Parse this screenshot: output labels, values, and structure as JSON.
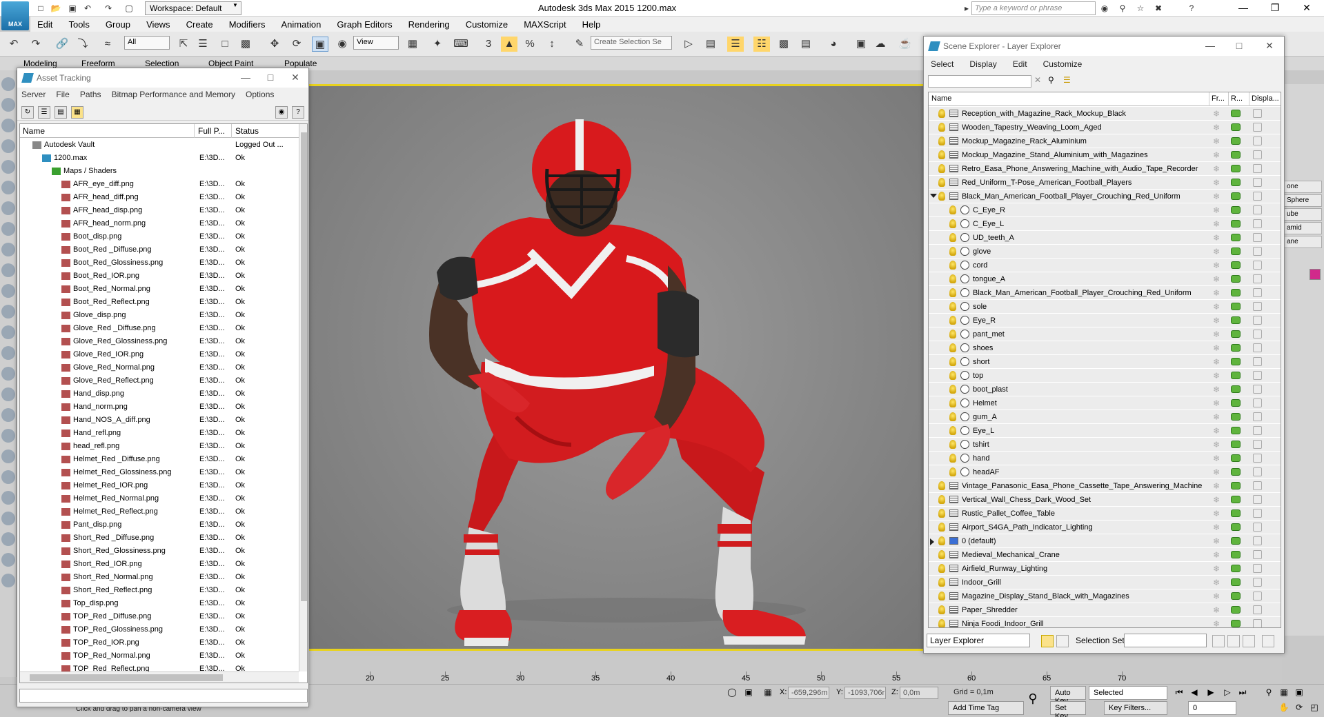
{
  "app": {
    "logo_text": "MAX",
    "title": "Autodesk 3ds Max  2015     1200.max",
    "workspace": "Workspace: Default",
    "search_placeholder": "Type a keyword or phrase"
  },
  "menu": [
    "Edit",
    "Tools",
    "Group",
    "Views",
    "Create",
    "Modifiers",
    "Animation",
    "Graph Editors",
    "Rendering",
    "Customize",
    "MAXScript",
    "Help"
  ],
  "toolbar": {
    "selection_filter": "All",
    "ref_coord": "View",
    "named_selection_placeholder": "Create Selection Se"
  },
  "ribbon_tabs": [
    "Modeling",
    "Freeform",
    "Selection",
    "Object Paint",
    "Populate"
  ],
  "right_panel": {
    "buttons": [
      "one",
      "Sphere",
      "ube",
      "amid",
      "ane"
    ],
    "accent": "#d12a8b"
  },
  "asset_tracking": {
    "title": "Asset Tracking",
    "menu": [
      "Server",
      "File",
      "Paths",
      "Bitmap Performance and Memory",
      "Options"
    ],
    "columns": [
      "Name",
      "Full P...",
      "Status"
    ],
    "rows": [
      {
        "name": "Autodesk Vault",
        "path": "",
        "status": "Logged Out ...",
        "level": 0,
        "icon": "vault"
      },
      {
        "name": "1200.max",
        "path": "E:\\3D...",
        "status": "Ok",
        "level": 1,
        "icon": "max-file"
      },
      {
        "name": "Maps / Shaders",
        "path": "",
        "status": "",
        "level": 2,
        "icon": "folder"
      },
      {
        "name": "AFR_eye_diff.png",
        "path": "E:\\3D...",
        "status": "Ok",
        "level": 3,
        "icon": "bitmap"
      },
      {
        "name": "AFR_head_diff.png",
        "path": "E:\\3D...",
        "status": "Ok",
        "level": 3,
        "icon": "bitmap"
      },
      {
        "name": "AFR_head_disp.png",
        "path": "E:\\3D...",
        "status": "Ok",
        "level": 3,
        "icon": "bitmap"
      },
      {
        "name": "AFR_head_norm.png",
        "path": "E:\\3D...",
        "status": "Ok",
        "level": 3,
        "icon": "bitmap"
      },
      {
        "name": "Boot_disp.png",
        "path": "E:\\3D...",
        "status": "Ok",
        "level": 3,
        "icon": "bitmap"
      },
      {
        "name": "Boot_Red _Diffuse.png",
        "path": "E:\\3D...",
        "status": "Ok",
        "level": 3,
        "icon": "bitmap"
      },
      {
        "name": "Boot_Red_Glossiness.png",
        "path": "E:\\3D...",
        "status": "Ok",
        "level": 3,
        "icon": "bitmap"
      },
      {
        "name": "Boot_Red_IOR.png",
        "path": "E:\\3D...",
        "status": "Ok",
        "level": 3,
        "icon": "bitmap"
      },
      {
        "name": "Boot_Red_Normal.png",
        "path": "E:\\3D...",
        "status": "Ok",
        "level": 3,
        "icon": "bitmap"
      },
      {
        "name": "Boot_Red_Reflect.png",
        "path": "E:\\3D...",
        "status": "Ok",
        "level": 3,
        "icon": "bitmap"
      },
      {
        "name": "Glove_disp.png",
        "path": "E:\\3D...",
        "status": "Ok",
        "level": 3,
        "icon": "bitmap"
      },
      {
        "name": "Glove_Red _Diffuse.png",
        "path": "E:\\3D...",
        "status": "Ok",
        "level": 3,
        "icon": "bitmap"
      },
      {
        "name": "Glove_Red_Glossiness.png",
        "path": "E:\\3D...",
        "status": "Ok",
        "level": 3,
        "icon": "bitmap"
      },
      {
        "name": "Glove_Red_IOR.png",
        "path": "E:\\3D...",
        "status": "Ok",
        "level": 3,
        "icon": "bitmap"
      },
      {
        "name": "Glove_Red_Normal.png",
        "path": "E:\\3D...",
        "status": "Ok",
        "level": 3,
        "icon": "bitmap"
      },
      {
        "name": "Glove_Red_Reflect.png",
        "path": "E:\\3D...",
        "status": "Ok",
        "level": 3,
        "icon": "bitmap"
      },
      {
        "name": "Hand_disp.png",
        "path": "E:\\3D...",
        "status": "Ok",
        "level": 3,
        "icon": "bitmap"
      },
      {
        "name": "Hand_norm.png",
        "path": "E:\\3D...",
        "status": "Ok",
        "level": 3,
        "icon": "bitmap"
      },
      {
        "name": "Hand_NOS_A_diff.png",
        "path": "E:\\3D...",
        "status": "Ok",
        "level": 3,
        "icon": "bitmap"
      },
      {
        "name": "Hand_refl.png",
        "path": "E:\\3D...",
        "status": "Ok",
        "level": 3,
        "icon": "bitmap"
      },
      {
        "name": "head_refl.png",
        "path": "E:\\3D...",
        "status": "Ok",
        "level": 3,
        "icon": "bitmap"
      },
      {
        "name": "Helmet_Red _Diffuse.png",
        "path": "E:\\3D...",
        "status": "Ok",
        "level": 3,
        "icon": "bitmap"
      },
      {
        "name": "Helmet_Red_Glossiness.png",
        "path": "E:\\3D...",
        "status": "Ok",
        "level": 3,
        "icon": "bitmap"
      },
      {
        "name": "Helmet_Red_IOR.png",
        "path": "E:\\3D...",
        "status": "Ok",
        "level": 3,
        "icon": "bitmap"
      },
      {
        "name": "Helmet_Red_Normal.png",
        "path": "E:\\3D...",
        "status": "Ok",
        "level": 3,
        "icon": "bitmap"
      },
      {
        "name": "Helmet_Red_Reflect.png",
        "path": "E:\\3D...",
        "status": "Ok",
        "level": 3,
        "icon": "bitmap"
      },
      {
        "name": "Pant_disp.png",
        "path": "E:\\3D...",
        "status": "Ok",
        "level": 3,
        "icon": "bitmap"
      },
      {
        "name": "Short_Red _Diffuse.png",
        "path": "E:\\3D...",
        "status": "Ok",
        "level": 3,
        "icon": "bitmap"
      },
      {
        "name": "Short_Red_Glossiness.png",
        "path": "E:\\3D...",
        "status": "Ok",
        "level": 3,
        "icon": "bitmap"
      },
      {
        "name": "Short_Red_IOR.png",
        "path": "E:\\3D...",
        "status": "Ok",
        "level": 3,
        "icon": "bitmap"
      },
      {
        "name": "Short_Red_Normal.png",
        "path": "E:\\3D...",
        "status": "Ok",
        "level": 3,
        "icon": "bitmap"
      },
      {
        "name": "Short_Red_Reflect.png",
        "path": "E:\\3D...",
        "status": "Ok",
        "level": 3,
        "icon": "bitmap"
      },
      {
        "name": "Top_disp.png",
        "path": "E:\\3D...",
        "status": "Ok",
        "level": 3,
        "icon": "bitmap"
      },
      {
        "name": "TOP_Red _Diffuse.png",
        "path": "E:\\3D...",
        "status": "Ok",
        "level": 3,
        "icon": "bitmap"
      },
      {
        "name": "TOP_Red_Glossiness.png",
        "path": "E:\\3D...",
        "status": "Ok",
        "level": 3,
        "icon": "bitmap"
      },
      {
        "name": "TOP_Red_IOR.png",
        "path": "E:\\3D...",
        "status": "Ok",
        "level": 3,
        "icon": "bitmap"
      },
      {
        "name": "TOP_Red_Normal.png",
        "path": "E:\\3D...",
        "status": "Ok",
        "level": 3,
        "icon": "bitmap"
      },
      {
        "name": "TOP_Red_Reflect.png",
        "path": "E:\\3D...",
        "status": "Ok",
        "level": 3,
        "icon": "bitmap"
      }
    ]
  },
  "scene_explorer": {
    "title": "Scene Explorer - Layer Explorer",
    "menu": [
      "Select",
      "Display",
      "Edit",
      "Customize"
    ],
    "columns": [
      "Name",
      "Fr...",
      "R...",
      "Displa..."
    ],
    "rows": [
      {
        "name": "Reception_with_Magazine_Rack_Mockup_Black",
        "type": "layer",
        "expand": ""
      },
      {
        "name": "Wooden_Tapestry_Weaving_Loom_Aged",
        "type": "layer",
        "expand": ""
      },
      {
        "name": "Mockup_Magazine_Rack_Aluminium",
        "type": "layer",
        "expand": ""
      },
      {
        "name": "Mockup_Magazine_Stand_Aluminium_with_Magazines",
        "type": "layer",
        "expand": ""
      },
      {
        "name": "Retro_Easa_Phone_Answering_Machine_with_Audio_Tape_Recorder",
        "type": "layer",
        "expand": ""
      },
      {
        "name": "Red_Uniform_T-Pose_American_Football_Players",
        "type": "layer",
        "expand": ""
      },
      {
        "name": "Black_Man_American_Football_Player_Crouching_Red_Uniform",
        "type": "layer",
        "expand": "open"
      },
      {
        "name": "C_Eye_R",
        "type": "object",
        "expand": ""
      },
      {
        "name": "C_Eye_L",
        "type": "object",
        "expand": ""
      },
      {
        "name": "UD_teeth_A",
        "type": "object",
        "expand": ""
      },
      {
        "name": "glove",
        "type": "object",
        "expand": ""
      },
      {
        "name": "cord",
        "type": "object",
        "expand": ""
      },
      {
        "name": "tongue_A",
        "type": "object",
        "expand": ""
      },
      {
        "name": "Black_Man_American_Football_Player_Crouching_Red_Uniform",
        "type": "group",
        "expand": ""
      },
      {
        "name": "sole",
        "type": "object",
        "expand": ""
      },
      {
        "name": "Eye_R",
        "type": "object",
        "expand": ""
      },
      {
        "name": "pant_met",
        "type": "object",
        "expand": ""
      },
      {
        "name": "shoes",
        "type": "object",
        "expand": ""
      },
      {
        "name": "short",
        "type": "object",
        "expand": ""
      },
      {
        "name": "top",
        "type": "object",
        "expand": ""
      },
      {
        "name": "boot_plast",
        "type": "object",
        "expand": ""
      },
      {
        "name": "Helmet",
        "type": "object",
        "expand": ""
      },
      {
        "name": "gum_A",
        "type": "object",
        "expand": ""
      },
      {
        "name": "Eye_L",
        "type": "object",
        "expand": ""
      },
      {
        "name": "tshirt",
        "type": "object",
        "expand": ""
      },
      {
        "name": "hand",
        "type": "object",
        "expand": ""
      },
      {
        "name": "headAF",
        "type": "object",
        "expand": ""
      },
      {
        "name": "Vintage_Panasonic_Easa_Phone_Cassette_Tape_Answering_Machine",
        "type": "layer",
        "expand": ""
      },
      {
        "name": "Vertical_Wall_Chess_Dark_Wood_Set",
        "type": "layer",
        "expand": ""
      },
      {
        "name": "Rustic_Pallet_Coffee_Table",
        "type": "layer",
        "expand": ""
      },
      {
        "name": "Airport_S4GA_Path_Indicator_Lighting",
        "type": "layer",
        "expand": ""
      },
      {
        "name": "0 (default)",
        "type": "default-layer",
        "expand": "closed"
      },
      {
        "name": "Medieval_Mechanical_Crane",
        "type": "layer",
        "expand": ""
      },
      {
        "name": "Airfield_Runway_Lighting",
        "type": "layer",
        "expand": ""
      },
      {
        "name": "Indoor_Grill",
        "type": "layer",
        "expand": ""
      },
      {
        "name": "Magazine_Display_Stand_Black_with_Magazines",
        "type": "layer",
        "expand": ""
      },
      {
        "name": "Paper_Shredder",
        "type": "layer",
        "expand": ""
      },
      {
        "name": "Ninja Foodi_Indoor_Grill",
        "type": "layer",
        "expand": ""
      }
    ],
    "bottom": {
      "explorer_combo": "Layer Explorer",
      "selection_set_label": "Selection Set:"
    }
  },
  "timeline": {
    "ticks": [
      "20",
      "25",
      "30",
      "35",
      "40",
      "45",
      "50",
      "55",
      "60",
      "65",
      "70"
    ]
  },
  "status": {
    "message": "Click and drag to pan a non-camera view",
    "x_label": "X:",
    "x_value": "-659,296m",
    "y_label": "Y:",
    "y_value": "-1093,706r",
    "z_label": "Z:",
    "z_value": "0,0m",
    "grid": "Grid = 0,1m",
    "add_time_tag": "Add Time Tag",
    "auto_key": "Auto Key",
    "set_key": "Set Key",
    "selected": "Selected",
    "key_filters": "Key Filters...",
    "frame": "0"
  }
}
